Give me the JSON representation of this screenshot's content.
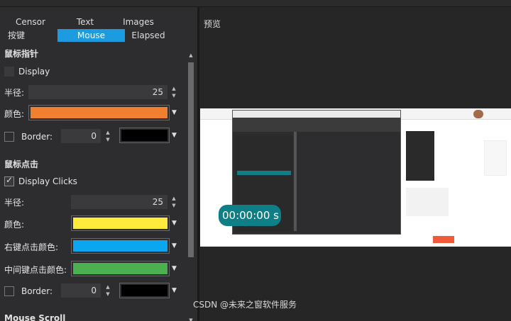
{
  "tabs": {
    "row1": [
      "Censor",
      "Text",
      "Images"
    ],
    "row2": [
      "按键",
      "Mouse",
      "Elapsed"
    ],
    "active": "Mouse"
  },
  "pointer": {
    "section_title": "鼠标指针",
    "display_label": "Display",
    "radius_label": "半径:",
    "radius_value": "25",
    "color_label": "颜色:",
    "color": "#f08030",
    "border_label": "Border:",
    "border_value": "0",
    "border_color": "#000000"
  },
  "clicks": {
    "section_title": "鼠标点击",
    "display_label": "Display Clicks",
    "radius_label": "半径:",
    "radius_value": "25",
    "color_label": "颜色:",
    "color": "#ffeb3b",
    "right_label": "右键点击颜色:",
    "right_color": "#0aa6f0",
    "middle_label": "中间键点击颜色:",
    "middle_color": "#4caf50",
    "border_label": "Border:",
    "border_value": "0",
    "border_color": "#000000"
  },
  "scroll": {
    "section_title": "Mouse Scroll"
  },
  "preview": {
    "label": "预览",
    "timer_text": "00:00:00 s"
  },
  "watermark": "CSDN @未来之窗软件服务",
  "colors": {
    "accent": "#1d9be0",
    "timer_bg": "#0e7f86"
  }
}
